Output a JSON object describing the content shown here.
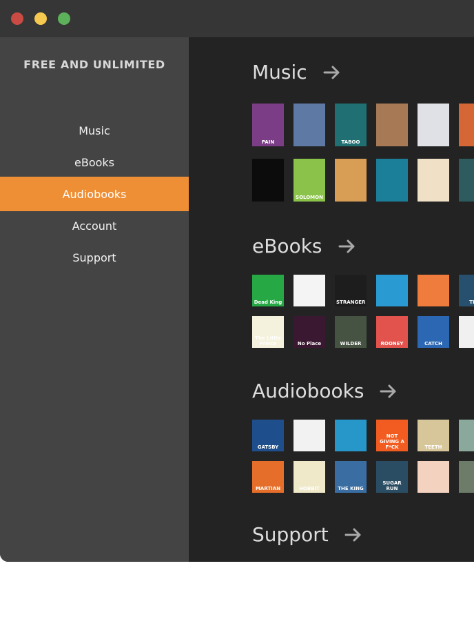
{
  "window": {
    "brand": "FREE AND UNLIMITED"
  },
  "sidebar": {
    "items": [
      {
        "label": "Music",
        "active": false
      },
      {
        "label": "eBooks",
        "active": false
      },
      {
        "label": "Audiobooks",
        "active": true
      },
      {
        "label": "Account",
        "active": false
      },
      {
        "label": "Support",
        "active": false
      }
    ]
  },
  "sections": [
    {
      "title": "Music"
    },
    {
      "title": "eBooks"
    },
    {
      "title": "Audiobooks"
    },
    {
      "title": "Support"
    }
  ],
  "covers": {
    "music_row1": [
      {
        "text": "PAIN",
        "color": "#7a3d86"
      },
      {
        "text": "",
        "color": "#5f79a5"
      },
      {
        "text": "TABOO",
        "color": "#1f6f73"
      },
      {
        "text": "",
        "color": "#a77a55"
      },
      {
        "text": "",
        "color": "#dfe1e6"
      },
      {
        "text": "",
        "color": "#d56737"
      }
    ],
    "music_row2": [
      {
        "text": "",
        "color": "#0c0c0c"
      },
      {
        "text": "SOLOMON",
        "color": "#8bc34a"
      },
      {
        "text": "",
        "color": "#d99e55"
      },
      {
        "text": "",
        "color": "#1b7f9a"
      },
      {
        "text": "",
        "color": "#f0e1c6"
      },
      {
        "text": "",
        "color": "#2d5b5e"
      }
    ],
    "ebooks_row1": [
      {
        "text": "Dead King",
        "color": "#26a844"
      },
      {
        "text": "",
        "color": "#f4f4f4"
      },
      {
        "text": "STRANGER",
        "color": "#1d1d1d"
      },
      {
        "text": "",
        "color": "#2a9bd2"
      },
      {
        "text": "",
        "color": "#ef7c3c"
      },
      {
        "text": "THE",
        "color": "#26506d"
      }
    ],
    "ebooks_row2": [
      {
        "text": "The Little Prince",
        "color": "#f4f1dc"
      },
      {
        "text": "No Place",
        "color": "#3b1831"
      },
      {
        "text": "WILDER",
        "color": "#465343"
      },
      {
        "text": "ROONEY",
        "color": "#e3534d"
      },
      {
        "text": "CATCH",
        "color": "#2c67b3"
      },
      {
        "text": "",
        "color": "#f0f0f0"
      }
    ],
    "audio_row1": [
      {
        "text": "GATSBY",
        "color": "#1f4e8c"
      },
      {
        "text": "",
        "color": "#f2f2f2"
      },
      {
        "text": "",
        "color": "#2796c9"
      },
      {
        "text": "NOT GIVING A F*CK",
        "color": "#f25c21"
      },
      {
        "text": "TEETH",
        "color": "#d8c69b"
      },
      {
        "text": "",
        "color": "#8aa89c"
      }
    ],
    "audio_row2": [
      {
        "text": "MARTIAN",
        "color": "#e56f2a"
      },
      {
        "text": "HOBBIT",
        "color": "#efe8c9"
      },
      {
        "text": "THE KING",
        "color": "#3a6ea3"
      },
      {
        "text": "SUGAR RUN",
        "color": "#2b4d63"
      },
      {
        "text": "",
        "color": "#f3d2c0"
      },
      {
        "text": "",
        "color": "#6c7c68"
      }
    ]
  }
}
